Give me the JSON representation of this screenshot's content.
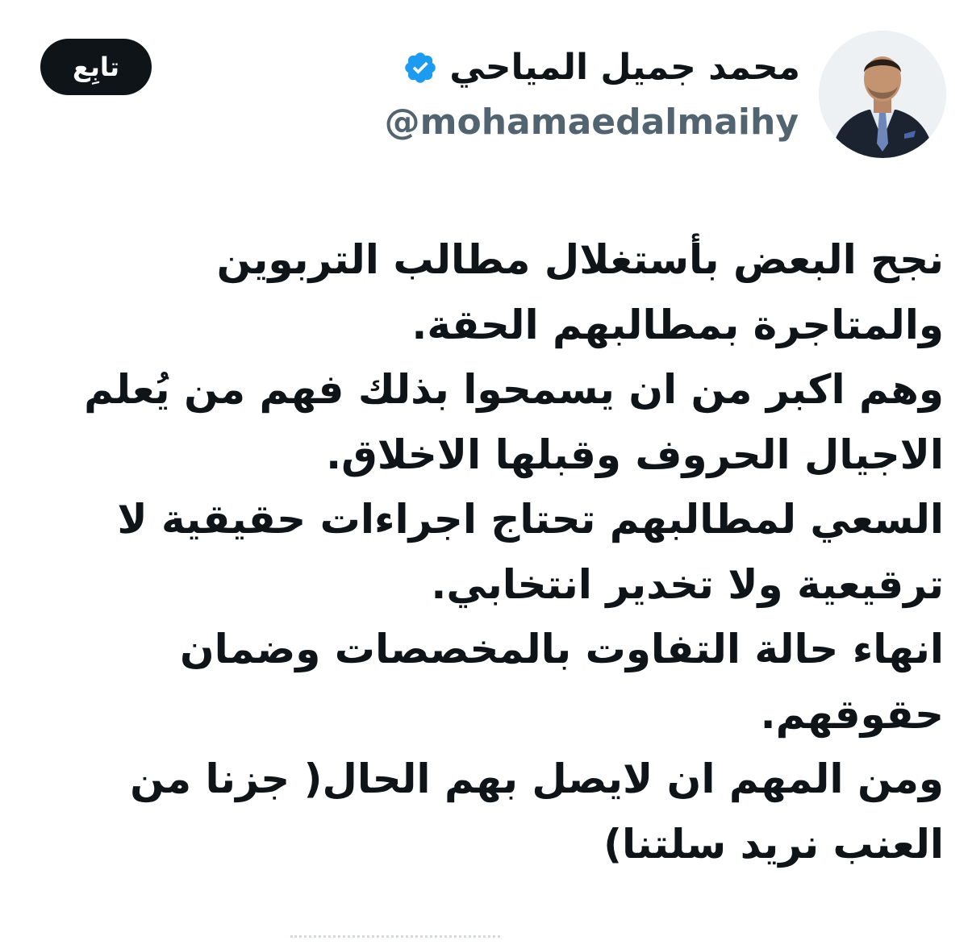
{
  "author": {
    "display_name": "محمد جميل المياحي",
    "handle": "@mohamaedalmaihy",
    "verified": true,
    "avatar_icon": "profile-photo-man-in-suit"
  },
  "follow_button": {
    "label": "تابِع"
  },
  "tweet": {
    "lines": [
      "نجح البعض بأستغلال مطالب التربوين",
      "والمتاجرة بمطالبهم الحقة.",
      "وهم اكبر من ان يسمحوا بذلك فهم من يُعلم",
      "الاجيال الحروف وقبلها الاخلاق.",
      "السعي لمطالبهم تحتاج اجراءات حقيقية لا",
      "ترقيعية ولا تخدير انتخابي.",
      "انهاء حالة التفاوت بالمخصصات وضمان",
      "حقوقهم.",
      "ومن المهم ان لايصل بهم الحال( جزنا من",
      "العنب نريد سلتنا)"
    ]
  },
  "colors": {
    "text": "#0f1419",
    "secondary_text": "#536471",
    "verified_badge": "#1d9bf0",
    "follow_button_bg": "#0f1419",
    "follow_button_text": "#ffffff"
  }
}
